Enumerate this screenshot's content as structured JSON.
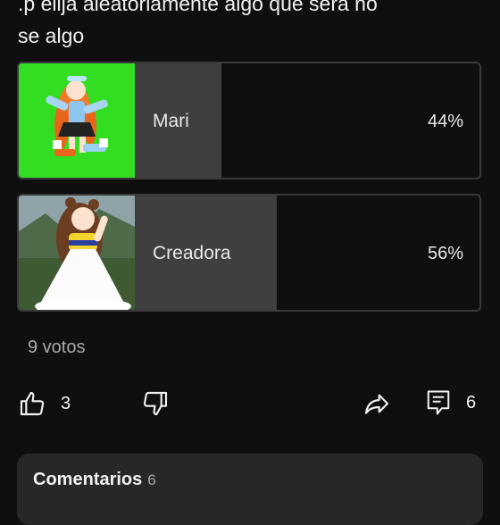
{
  "post": {
    "text_line1": ".p elija aleatoriamente algo que sera no",
    "text_line2": "se algo"
  },
  "poll": {
    "options": [
      {
        "label": "Mari",
        "percent_text": "44%",
        "percent": 44,
        "thumb_bg": "#33dd22"
      },
      {
        "label": "Creadora",
        "percent_text": "56%",
        "percent": 56,
        "thumb_bg": "#5a6b55"
      }
    ],
    "votes": "9 votos"
  },
  "actions": {
    "like_count": "3",
    "comment_count": "6",
    "like_icon": "thumbs-up-icon",
    "dislike_icon": "thumbs-down-icon",
    "share_icon": "share-icon",
    "comment_icon": "comment-icon"
  },
  "comments": {
    "title": "Comentarios",
    "count": "6"
  },
  "colors": {
    "background": "#0f0f0f",
    "poll_fill": "#3f3f3f",
    "panel": "#272727",
    "secondary_text": "#aaaaaa"
  }
}
